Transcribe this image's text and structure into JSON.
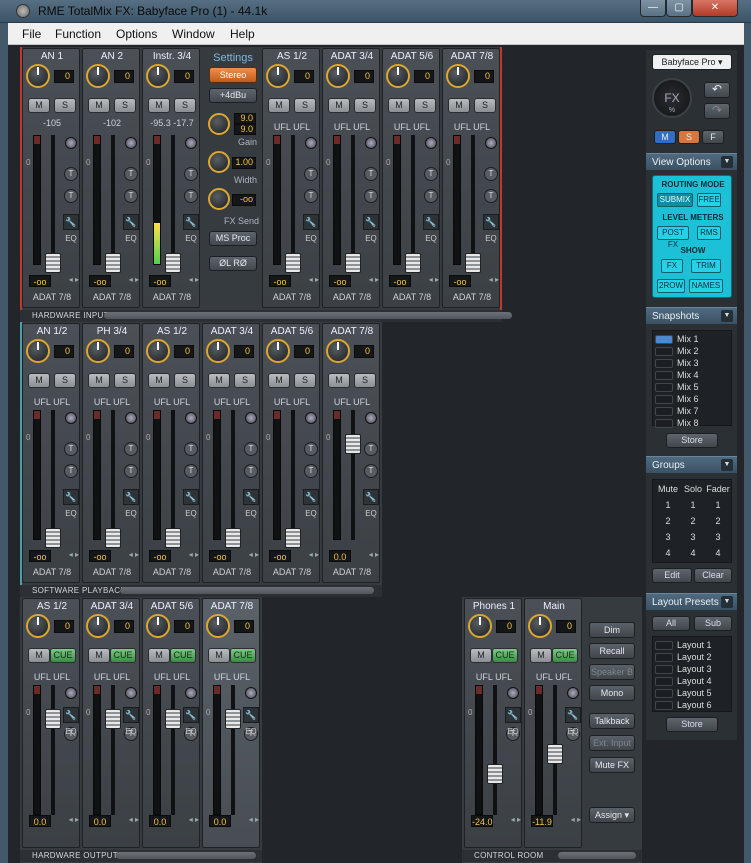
{
  "window": {
    "title": "RME TotalMix FX: Babyface Pro (1) - 44.1k",
    "min": "—",
    "max": "▢",
    "close": "✕"
  },
  "menu": [
    "File",
    "Function",
    "Options",
    "Window",
    "Help"
  ],
  "hw_inputs": {
    "label": "HARDWARE INPUTS",
    "channels": [
      {
        "name": "AN 1",
        "knob": "0",
        "m": "M",
        "s": "S",
        "meter": "-105",
        "level": 0,
        "fader": "-oo",
        "route": "ADAT 7/8"
      },
      {
        "name": "AN 2",
        "knob": "0",
        "m": "M",
        "s": "S",
        "meter": "-102",
        "level": 0,
        "fader": "-oo",
        "route": "ADAT 7/8"
      },
      {
        "name": "Instr. 3/4",
        "knob": "0",
        "m": "M",
        "s": "S",
        "meter": "-95.3 -17.7",
        "level": 0.32,
        "fader": "-oo",
        "route": "ADAT 7/8"
      },
      {
        "name": "AS 1/2",
        "knob": "0",
        "m": "M",
        "s": "S",
        "ufl": "UFL UFL",
        "level": 0,
        "fader": "-oo",
        "route": "ADAT 7/8"
      },
      {
        "name": "ADAT 3/4",
        "knob": "0",
        "m": "M",
        "s": "S",
        "ufl": "UFL UFL",
        "level": 0,
        "fader": "-oo",
        "route": "ADAT 7/8"
      },
      {
        "name": "ADAT 5/6",
        "knob": "0",
        "m": "M",
        "s": "S",
        "ufl": "UFL UFL",
        "level": 0,
        "fader": "-oo",
        "route": "ADAT 7/8"
      },
      {
        "name": "ADAT 7/8",
        "knob": "0",
        "m": "M",
        "s": "S",
        "ufl": "UFL UFL",
        "level": 0,
        "fader": "-oo",
        "route": "ADAT 7/8"
      }
    ]
  },
  "settings": {
    "title": "Settings",
    "stereo": "Stereo",
    "ref": "+4dBu",
    "gain1": "9.0",
    "gain2": "9.0",
    "gain_label": "Gain",
    "width_val": "1.00",
    "width_label": "Width",
    "fx_val": "-oo",
    "fx_label": "FX Send",
    "ms": "MS Proc",
    "phase": "ØL RØ"
  },
  "sw_playback": {
    "label": "SOFTWARE PLAYBACK",
    "channels": [
      {
        "name": "AN 1/2",
        "knob": "0",
        "m": "M",
        "s": "S",
        "ufl": "UFL UFL",
        "fader": "-oo",
        "route": "ADAT 7/8"
      },
      {
        "name": "PH 3/4",
        "knob": "0",
        "m": "M",
        "s": "S",
        "ufl": "UFL UFL",
        "fader": "-oo",
        "route": "ADAT 7/8"
      },
      {
        "name": "AS 1/2",
        "knob": "0",
        "m": "M",
        "s": "S",
        "ufl": "UFL UFL",
        "fader": "-oo",
        "route": "ADAT 7/8"
      },
      {
        "name": "ADAT 3/4",
        "knob": "0",
        "m": "M",
        "s": "S",
        "ufl": "UFL UFL",
        "fader": "-oo",
        "route": "ADAT 7/8"
      },
      {
        "name": "ADAT 5/6",
        "knob": "0",
        "m": "M",
        "s": "S",
        "ufl": "UFL UFL",
        "fader": "-oo",
        "route": "ADAT 7/8"
      },
      {
        "name": "ADAT 7/8",
        "knob": "0",
        "m": "M",
        "s": "S",
        "ufl": "UFL UFL",
        "fader": "0.0",
        "route": "ADAT 7/8"
      }
    ]
  },
  "hw_outputs": {
    "label": "HARDWARE OUTPUTS",
    "channels": [
      {
        "name": "AS 1/2",
        "knob": "0",
        "m": "M",
        "cue": "CUE",
        "ufl": "UFL UFL",
        "fader": "0.0"
      },
      {
        "name": "ADAT 3/4",
        "knob": "0",
        "m": "M",
        "cue": "CUE",
        "ufl": "UFL UFL",
        "fader": "0.0"
      },
      {
        "name": "ADAT 5/6",
        "knob": "0",
        "m": "M",
        "cue": "CUE",
        "ufl": "UFL UFL",
        "fader": "0.0"
      },
      {
        "name": "ADAT 7/8",
        "knob": "0",
        "m": "M",
        "cue": "CUE",
        "ufl": "UFL UFL",
        "fader": "0.0"
      }
    ]
  },
  "control_room": {
    "label": "CONTROL ROOM",
    "channels": [
      {
        "name": "Phones 1",
        "knob": "0",
        "m": "M",
        "cue": "CUE",
        "ufl": "UFL UFL",
        "fader": "-24.0"
      },
      {
        "name": "Main",
        "knob": "0",
        "m": "M",
        "cue": "CUE",
        "ufl": "UFL UFL",
        "fader": "-11.9"
      }
    ],
    "buttons": [
      "Dim",
      "Recall",
      "Speaker B",
      "Mono",
      "Talkback",
      "Ext. Input",
      "Mute FX",
      "Assign ▾"
    ]
  },
  "icons": {
    "t": "T",
    "wrench": "🔧",
    "eq": "EQ",
    "arrows": "◂ ▸",
    "fx": "FX",
    "pct": "%"
  },
  "right": {
    "device": "Babyface Pro",
    "msf": [
      "M",
      "S",
      "F"
    ],
    "view_options": "View Options",
    "routing_mode": "ROUTING MODE",
    "submix": "SUBMIX",
    "free": "FREE",
    "level_meters": "LEVEL METERS",
    "postfx": "POST FX",
    "rms": "RMS",
    "show": "SHOW",
    "fx": "FX",
    "trim": "TRIM",
    "row2": "2ROW",
    "names": "NAMES",
    "snapshots": "Snapshots",
    "mixes": [
      "Mix 1",
      "Mix 2",
      "Mix 3",
      "Mix 4",
      "Mix 5",
      "Mix 6",
      "Mix 7",
      "Mix 8"
    ],
    "store": "Store",
    "groups": "Groups",
    "gcols": [
      "Mute",
      "Solo",
      "Fader"
    ],
    "grows": [
      [
        "1",
        "1",
        "1"
      ],
      [
        "2",
        "2",
        "2"
      ],
      [
        "3",
        "3",
        "3"
      ],
      [
        "4",
        "4",
        "4"
      ]
    ],
    "edit": "Edit",
    "clear": "Clear",
    "layout_presets": "Layout Presets",
    "all": "All",
    "sub": "Sub",
    "layouts": [
      "Layout 1",
      "Layout 2",
      "Layout 3",
      "Layout 4",
      "Layout 5",
      "Layout 6"
    ],
    "store2": "Store"
  }
}
